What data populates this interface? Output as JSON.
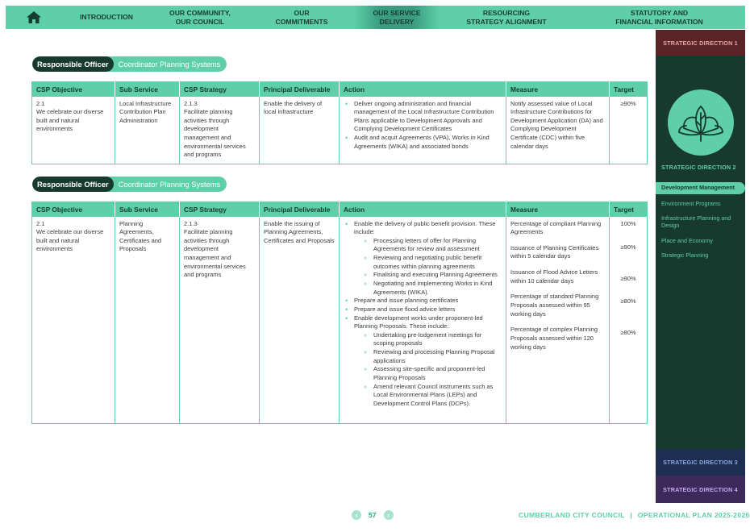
{
  "nav": {
    "home_icon": "home-icon",
    "items": [
      {
        "label": "INTRODUCTION"
      },
      {
        "label": "OUR COMMUNITY,\nOUR COUNCIL"
      },
      {
        "label": "OUR\nCOMMITMENTS"
      },
      {
        "label": "OUR SERVICE\nDELIVERY"
      },
      {
        "label": "RESOURCING\nSTRATEGY ALIGNMENT"
      },
      {
        "label": "STATUTORY AND\nFINANCIAL INFORMATION"
      }
    ],
    "active_index": 3
  },
  "sidebar": {
    "sd1": "STRATEGIC DIRECTION 1",
    "sd2": "STRATEGIC DIRECTION 2",
    "sd2_icon": "lotus-leaf-icon",
    "sd2_items": [
      {
        "label": "Development Management"
      },
      {
        "label": "Environment Programs"
      },
      {
        "label": "Infrastructure Planning and Design"
      },
      {
        "label": "Place and Economy"
      },
      {
        "label": "Strategic Planning"
      }
    ],
    "sd3": "STRATEGIC DIRECTION 3",
    "sd4": "STRATEGIC DIRECTION 4"
  },
  "colors": {
    "accent": "#5ecfa9",
    "dark_green": "#17392e",
    "sd1": "#5a2326",
    "sd3": "#1d2e52",
    "sd4": "#3e2a5a"
  },
  "headers": {
    "csp_objective": "CSP Objective",
    "sub_service": "Sub Service",
    "csp_strategy": "CSP Strategy",
    "principal_deliverable": "Principal Deliverable",
    "action": "Action",
    "measure": "Measure",
    "target": "Target"
  },
  "block1": {
    "officer_label": "Responsible Officer",
    "officer_value": "Coordinator Planning Systems",
    "objective": "2.1\nWe celebrate our diverse built and natural environments",
    "sub_service": "Local Infrastructure Contribution Plan Administration",
    "strategy": "2.1.3\nFacilitate planning activities through development management and environmental services and programs",
    "deliverable": "Enable the delivery of local infrastructure",
    "actions": [
      "Deliver ongoing administration and financial management of the Local Infrastructure Contribution Plans applicable to Development Approvals and Complying Development Certificates",
      "Audit and acquit Agreements (VPA), Works in Kind Agreements (WIKA) and associated bonds"
    ],
    "measure": "Notify assessed value of Local Infrastructure Contributions for Development Application (DA) and Complying Development Certificate (CDC) within five calendar days",
    "target": "≥90%"
  },
  "block2": {
    "officer_label": "Responsible Officer",
    "officer_value": "Coordinator Planning Systems",
    "objective": "2.1\nWe celebrate our diverse built and natural environments",
    "sub_service": "Planning Agreements, Certificates and Proposals",
    "strategy": "2.1.3\nFacilitate planning activities through development management and environmental services and programs",
    "deliverable": "Enable the issuing of Planning Agreements, Certificates and Proposals",
    "actions": [
      {
        "text": "Enable the delivery of public benefit provision. These include:",
        "sub": [
          "Processing letters of offer for Planning Agreements for review and assessment",
          "Reviewing and negotiating public benefit outcomes within planning agreements",
          "Finalising and executing Planning Agreements",
          "Negotiating and implementing Works in Kind Agreements (WIKA)."
        ]
      },
      {
        "text": "Prepare and issue planning certificates",
        "sub": []
      },
      {
        "text": "Prepare and issue flood advice letters",
        "sub": []
      },
      {
        "text": "Enable development works under proponent-led Planning Proposals. These include:",
        "sub": [
          "Undertaking pre-lodgement meetings for scoping proposals",
          "Reviewing and processing Planning Proposal applications",
          "Assessing site-specific and proponent-led Planning Proposals",
          "Amend relevant Council instruments such as Local Environmental Plans (LEPs) and Development Control Plans (DCPs)."
        ]
      }
    ],
    "measures": [
      {
        "measure": "Percentage of compliant Planning Agreements",
        "target": "100%"
      },
      {
        "measure": "Issuance of Planning Certificates within 5 calendar days",
        "target": "≥90%"
      },
      {
        "measure": "Issuance of Flood Advice Letters within 10 calendar days",
        "target": "≥90%"
      },
      {
        "measure": "Percentage of standard Planning Proposals assessed within 95 working days",
        "target": "≥80%"
      },
      {
        "measure": "Percentage of complex Planning Proposals assessed within 120 working days",
        "target": "≥80%"
      }
    ]
  },
  "footer": {
    "page_number": "57",
    "prev_icon": "chevron-left-icon",
    "next_icon": "chevron-right-icon",
    "council": "CUMBERLAND CITY COUNCIL",
    "separator": "|",
    "plan": "OPERATIONAL PLAN 2025-2026"
  }
}
